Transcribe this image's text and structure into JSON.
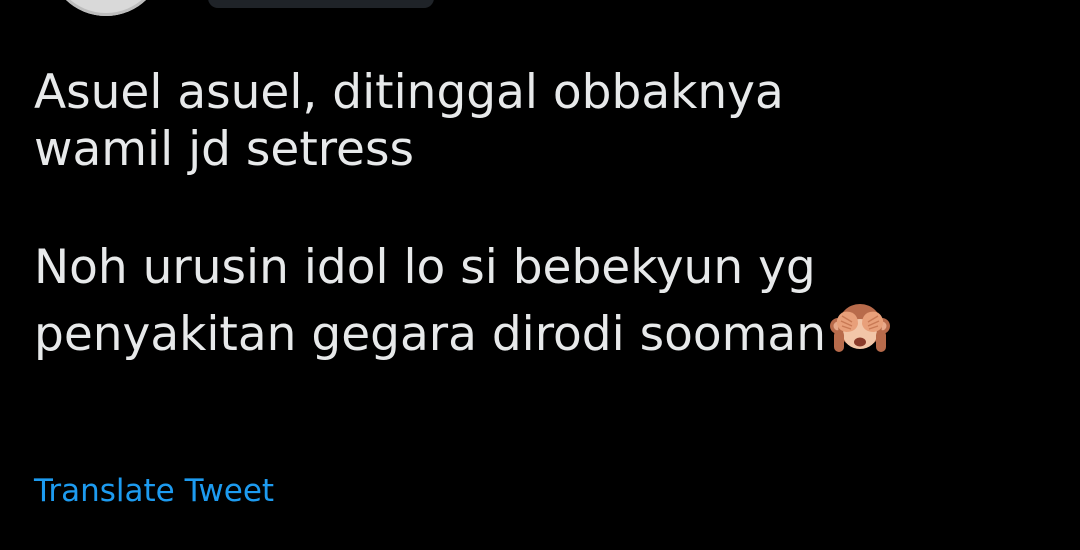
{
  "tweet": {
    "paragraph1": {
      "line1": "Asuel asuel, ditinggal obbaknya",
      "line2": "wamil jd setress"
    },
    "paragraph2": {
      "line1": "Noh urusin idol lo si bebekyun yg",
      "line2": "penyakitan gegara dirodi sooman"
    },
    "emoji": "see-no-evil-monkey-emoji"
  },
  "actions": {
    "translate_label": "Translate Tweet"
  },
  "colors": {
    "background": "#000000",
    "text": "#e7e9ea",
    "link": "#1d9bf0"
  }
}
